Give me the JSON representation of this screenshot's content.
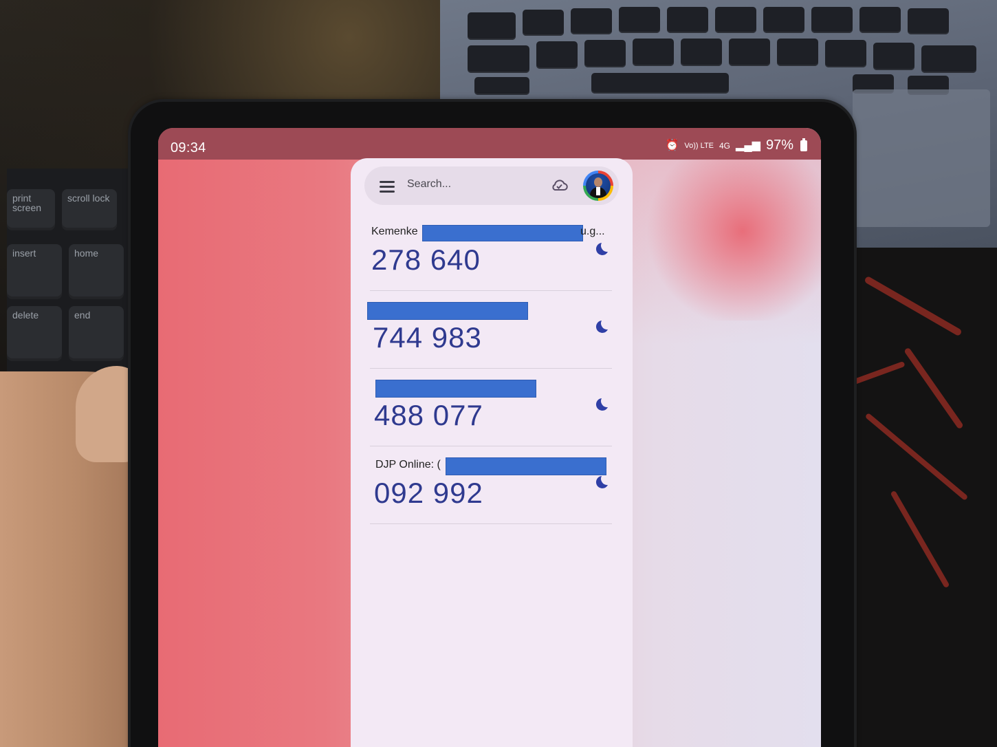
{
  "status_bar": {
    "time": "09:34",
    "battery": "97%",
    "network": "4G",
    "volte": "Vo)) LTE"
  },
  "search": {
    "placeholder": "Search..."
  },
  "icons": {
    "menu": "hamburger-menu-icon",
    "cloud": "cloud-sync-icon",
    "timer": "countdown-timer-icon",
    "alarm": "alarm-icon",
    "signal": "signal-icon",
    "battery": "battery-icon"
  },
  "accounts": [
    {
      "issuer_prefix": "Kemenke",
      "issuer_suffix": "u.g...",
      "code": "278 640"
    },
    {
      "issuer_prefix": "",
      "issuer_suffix": "",
      "code": "744 983"
    },
    {
      "issuer_prefix": "",
      "issuer_suffix": "",
      "code": "488 077"
    },
    {
      "issuer_prefix": "DJP Online: (",
      "issuer_suffix": "",
      "code": "092 992"
    }
  ],
  "keyboard_keys": {
    "print_screen": "print screen",
    "scroll_lock": "scroll lock",
    "insert": "insert",
    "home": "home",
    "delete": "delete",
    "end": "end"
  },
  "colors": {
    "code_blue": "#2f3a8f",
    "redaction_blue": "#3a6fcf",
    "app_background": "#f3e9f5",
    "status_bar": "#9d4a55"
  }
}
